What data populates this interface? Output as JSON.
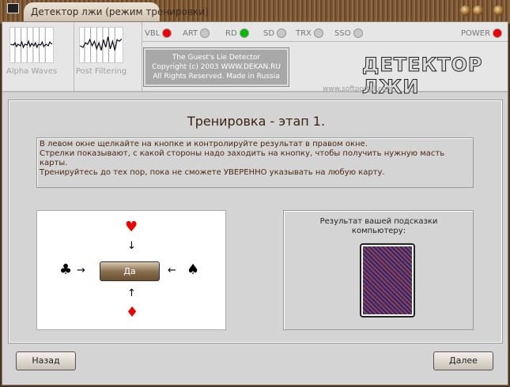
{
  "window": {
    "title": "Детектор лжи (режим тренировки)"
  },
  "header": {
    "alpha_label": "Alpha Waves",
    "post_label": "Post Filtering",
    "leds": [
      {
        "label": "VBL",
        "color": "#ee0000"
      },
      {
        "label": "ART",
        "color": "#c8c8c8"
      },
      {
        "label": "RD",
        "color": "#00bb00"
      },
      {
        "label": "SD",
        "color": "#c8c8c8"
      },
      {
        "label": "TRX",
        "color": "#c8c8c8"
      },
      {
        "label": "SSO",
        "color": "#c8c8c8"
      }
    ],
    "power": {
      "label": "POWER",
      "color": "#ee0000"
    },
    "copyright": [
      "The Guest's Lie Detector",
      "Copyright (c) 2003 WWW.DEKAN.RU",
      "All Rights Reserved. Made in Russia"
    ],
    "logo": "ДЕТЕКТОР ЛЖИ",
    "watermark": "www.softportal.com"
  },
  "main": {
    "title": "Тренировка - этап 1.",
    "instructions": [
      "В левом окне щелкайте на кнопке и контролируйте результат в правом окне.",
      "Стрелки показывают, с какой стороны надо заходить на кнопку, чтобы получить нужную масть карты.",
      "Тренируйтесь до тех пор, пока не сможете УВЕРЕННО указывать на любую карту."
    ],
    "trainer": {
      "yes_label": "Да",
      "top": "♥",
      "left": "♣",
      "right": "♠",
      "bottom": "♦",
      "arrow_down": "↓",
      "arrow_right": "→",
      "arrow_left": "←",
      "arrow_up": "↑"
    },
    "result": {
      "label": "Результат вашей подсказки компьютеру:"
    }
  },
  "footer": {
    "back": "Назад",
    "next": "Далее"
  }
}
